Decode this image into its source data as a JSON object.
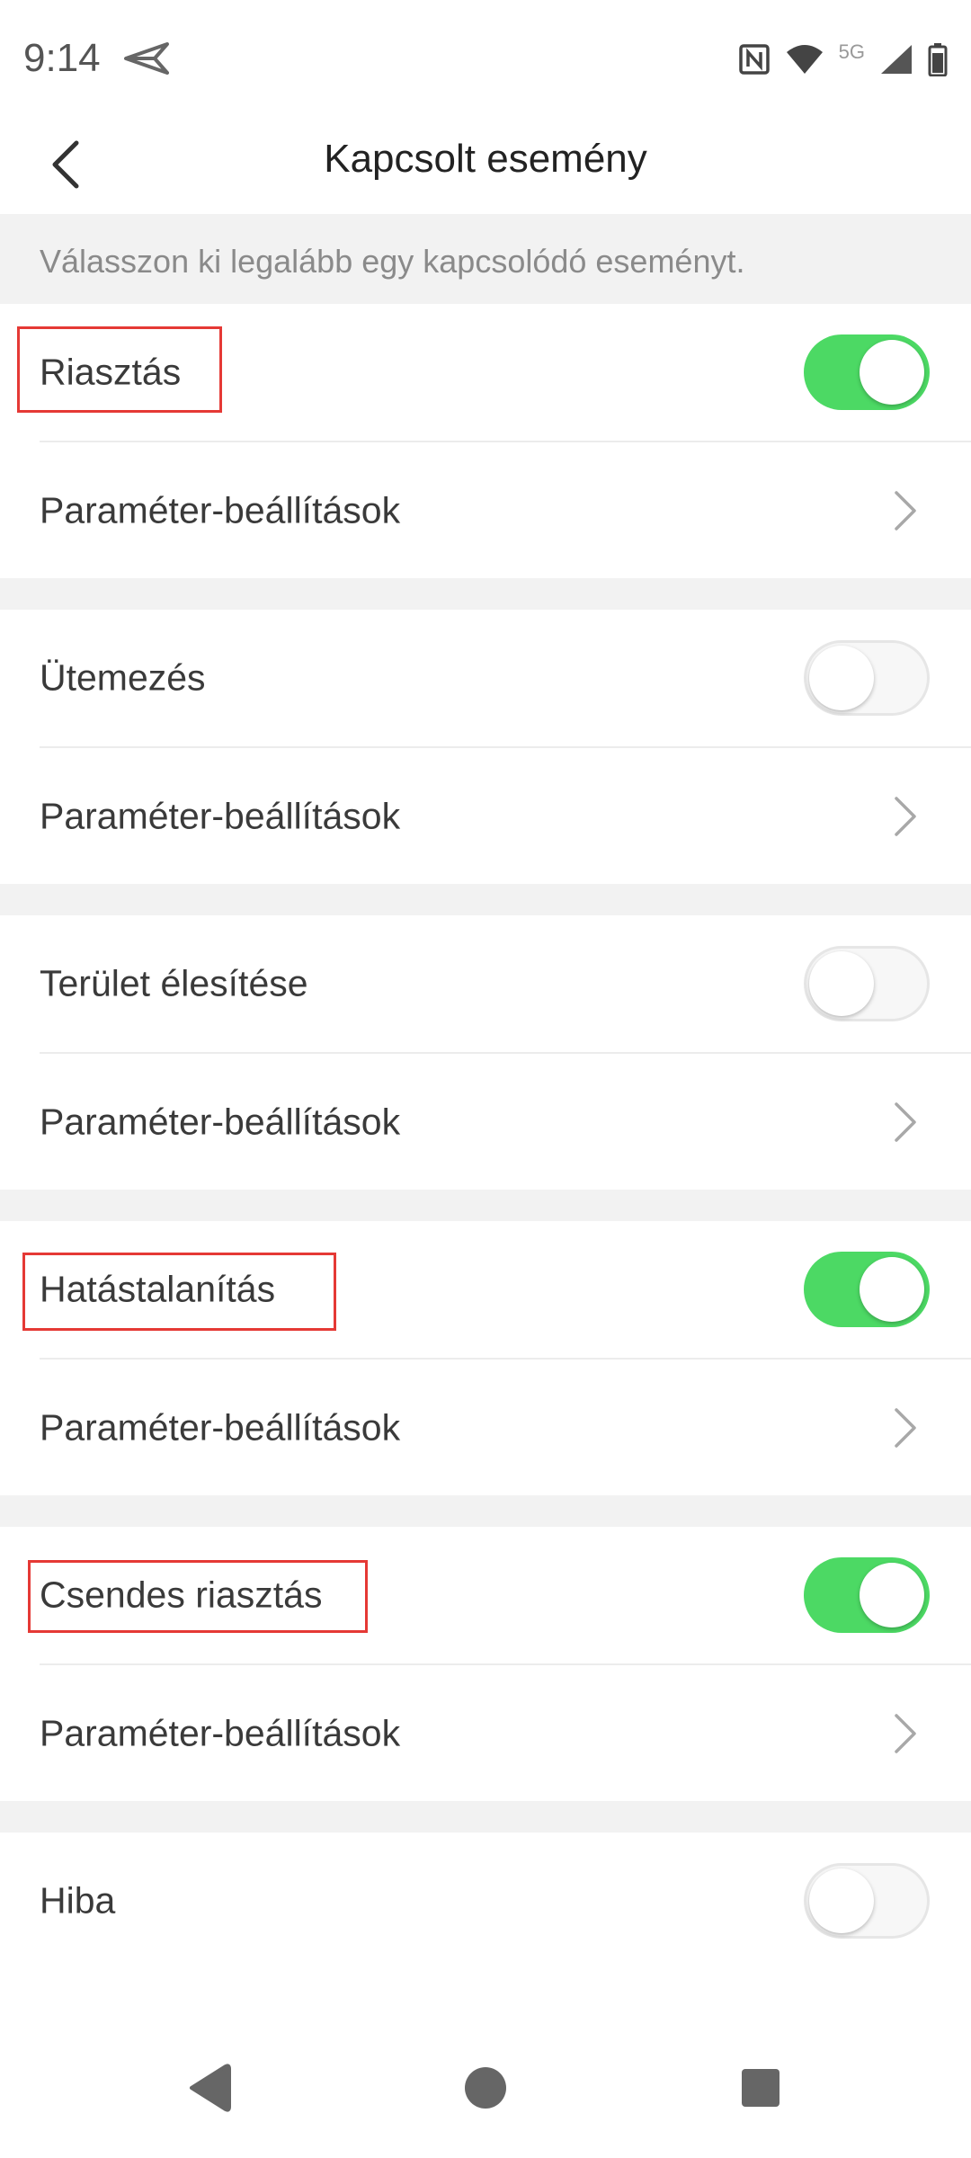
{
  "status_bar": {
    "time": "9:14",
    "network": "5G",
    "icons": [
      "send-icon",
      "nfc-icon",
      "wifi-icon",
      "signal-icon",
      "battery-icon"
    ]
  },
  "header": {
    "title": "Kapcsolt esemény",
    "back_icon": "chevron-left-icon"
  },
  "hint": "Válasszon ki legalább egy kapcsolódó eseményt.",
  "colors": {
    "toggle_on": "#4cd964",
    "toggle_off": "#f7f7f7",
    "highlight": "#e53935",
    "section_gap": "#f2f2f2"
  },
  "sections": [
    {
      "label": "Riasztás",
      "enabled": true,
      "highlighted": true,
      "param_label": "Paraméter-beállítások"
    },
    {
      "label": "Ütemezés",
      "enabled": false,
      "highlighted": false,
      "param_label": "Paraméter-beállítások"
    },
    {
      "label": "Terület élesítése",
      "enabled": false,
      "highlighted": false,
      "param_label": "Paraméter-beállítások"
    },
    {
      "label": "Hatástalanítás",
      "enabled": true,
      "highlighted": true,
      "param_label": "Paraméter-beállítások"
    },
    {
      "label": "Csendes riasztás",
      "enabled": true,
      "highlighted": true,
      "param_label": "Paraméter-beállítások"
    },
    {
      "label": "Hiba",
      "enabled": false,
      "highlighted": false
    }
  ],
  "nav": {
    "back_icon": "triangle-back-icon",
    "home_icon": "circle-home-icon",
    "recents_icon": "square-recents-icon"
  }
}
